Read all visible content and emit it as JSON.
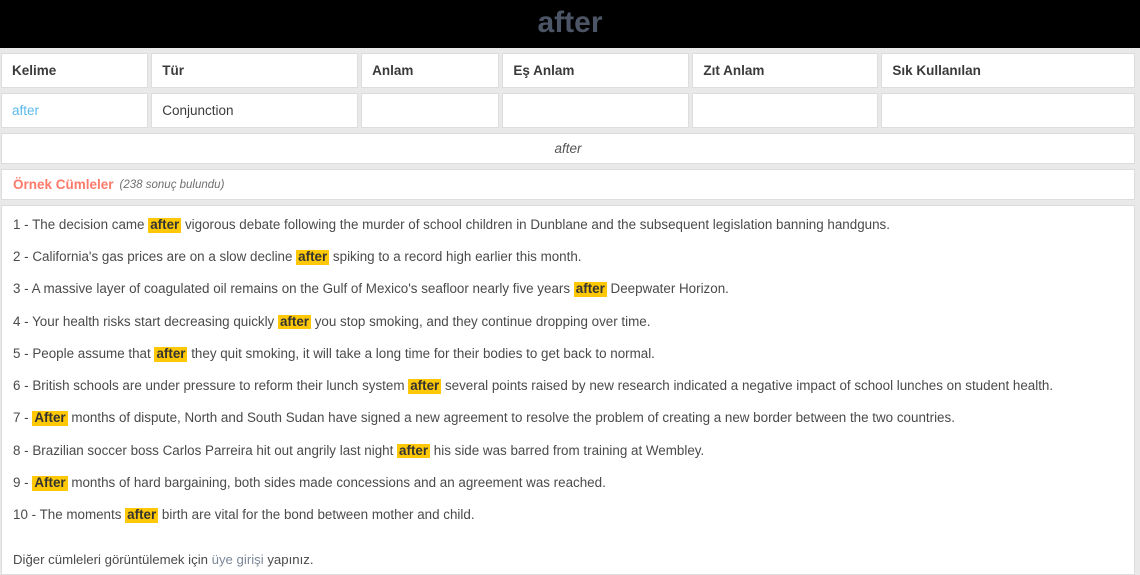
{
  "masthead": {
    "title": "after",
    "title_color": "#4c5566",
    "background": "#000000"
  },
  "word_table": {
    "headers": [
      "Kelime",
      "Tür",
      "Anlam",
      "Eş Anlam",
      "Zıt Anlam",
      "Sık Kullanılan"
    ],
    "rows": [
      {
        "kelime": "after",
        "tur": "Conjunction",
        "anlam": "",
        "es_anlam": "",
        "zit_anlam": "",
        "sik_kullanilan": ""
      }
    ],
    "link_color": "#5ab9ec"
  },
  "pronunciation": {
    "text": "after"
  },
  "examples": {
    "title": "Örnek Cümleler",
    "title_color": "#fb7a6a",
    "count_label": "(238 sonuç bulundu)",
    "highlight_color": "#ffc806",
    "items": [
      {
        "number": "1 - ",
        "before": "The decision came ",
        "highlight": "after",
        "after": " vigorous debate following the murder of school children in Dunblane and the subsequent legislation banning handguns."
      },
      {
        "number": "2 - ",
        "before": "California's gas prices are on a slow decline ",
        "highlight": "after",
        "after": " spiking to a record high earlier this month."
      },
      {
        "number": "3 - ",
        "before": "A massive layer of coagulated oil remains on the Gulf of Mexico's seafloor nearly five years ",
        "highlight": "after",
        "after": " Deepwater Horizon."
      },
      {
        "number": "4 - ",
        "before": "Your health risks start decreasing quickly ",
        "highlight": "after",
        "after": " you stop smoking, and they continue dropping over time."
      },
      {
        "number": "5 - ",
        "before": "People assume that ",
        "highlight": "after",
        "after": " they quit smoking, it will take a long time for their bodies to get back to normal."
      },
      {
        "number": "6 - ",
        "before": "British schools are under pressure to reform their lunch system ",
        "highlight": "after",
        "after": " several points raised by new research indicated a negative impact of school lunches on student health."
      },
      {
        "number": "7 - ",
        "before": "",
        "highlight": "After",
        "after": " months of dispute, North and South Sudan have signed a new agreement to resolve the problem of creating a new border between the two countries."
      },
      {
        "number": "8 - ",
        "before": "Brazilian soccer boss Carlos Parreira hit out angrily last night ",
        "highlight": "after",
        "after": " his side was barred from training at Wembley."
      },
      {
        "number": "9 - ",
        "before": "",
        "highlight": "After",
        "after": " months of hard bargaining, both sides made concessions and an agreement was reached."
      },
      {
        "number": "10 - ",
        "before": "The moments ",
        "highlight": "after",
        "after": " birth are vital for the bond between mother and child."
      }
    ],
    "footer": {
      "before": "Diğer cümleleri görüntülemek için ",
      "link": "üye girişi",
      "after": " yapınız."
    }
  }
}
